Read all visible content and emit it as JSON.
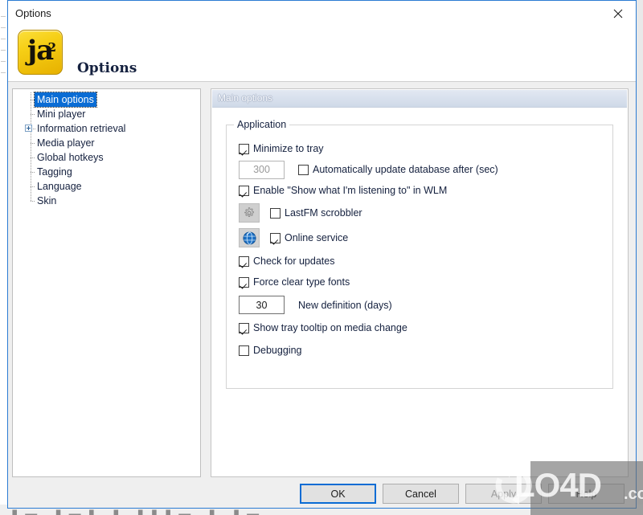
{
  "window": {
    "title": "Options",
    "close_icon": "close-x-icon",
    "header_title": "Options",
    "logo_glyph": "ja",
    "logo_superscript": "2"
  },
  "sidebar": {
    "items": [
      {
        "label": "Main options",
        "selected": true,
        "expandable": false
      },
      {
        "label": "Mini player",
        "selected": false,
        "expandable": false
      },
      {
        "label": "Information retrieval",
        "selected": false,
        "expandable": true
      },
      {
        "label": "Media player",
        "selected": false,
        "expandable": false
      },
      {
        "label": "Global hotkeys",
        "selected": false,
        "expandable": false
      },
      {
        "label": "Tagging",
        "selected": false,
        "expandable": false
      },
      {
        "label": "Language",
        "selected": false,
        "expandable": false
      },
      {
        "label": "Skin",
        "selected": false,
        "expandable": false
      }
    ]
  },
  "panel": {
    "header": "Main options",
    "group_title": "Application",
    "rows": {
      "minimize_to_tray": {
        "label": "Minimize to tray",
        "checked": true
      },
      "auto_update_value": "300",
      "auto_update": {
        "label": "Automatically update database after (sec)",
        "checked": false
      },
      "wlm": {
        "label": "Enable \"Show what I'm listening to\" in WLM",
        "checked": true
      },
      "lastfm": {
        "label": "LastFM scrobbler",
        "checked": false,
        "icon": "gear-icon"
      },
      "online_service": {
        "label": "Online service",
        "checked": true,
        "icon": "globe-icon"
      },
      "check_updates": {
        "label": "Check for updates",
        "checked": true
      },
      "clear_type": {
        "label": "Force clear type fonts",
        "checked": true
      },
      "new_definition_value": "30",
      "new_definition_label": "New definition (days)",
      "tray_tooltip": {
        "label": "Show tray tooltip on media change",
        "checked": true
      },
      "debugging": {
        "label": "Debugging",
        "checked": false
      }
    }
  },
  "buttons": {
    "ok": "OK",
    "cancel": "Cancel",
    "apply": "Apply",
    "help": "Help"
  },
  "watermark": {
    "text": "LO4D",
    "suffix": ".com",
    "logo": "circular-arrows-icon"
  },
  "colors": {
    "accent": "#0a6cd4",
    "selection": "#0a6cd4",
    "logo_yellow": "#f6cf16",
    "panel_header": "#cfd9e8"
  }
}
